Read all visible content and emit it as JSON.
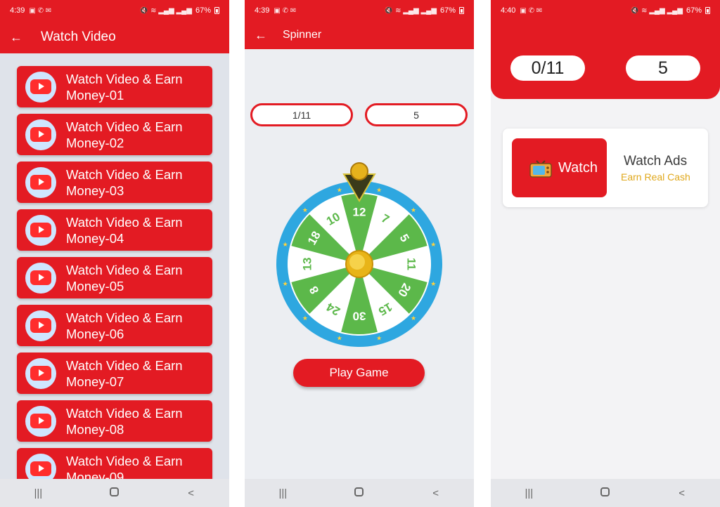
{
  "phone1": {
    "status": {
      "time": "4:39",
      "battery": "67%"
    },
    "appbar": {
      "title": "Watch Video"
    },
    "items": [
      {
        "label": "Watch Video & Earn Money-01"
      },
      {
        "label": "Watch Video & Earn Money-02"
      },
      {
        "label": "Watch Video & Earn Money-03"
      },
      {
        "label": "Watch Video & Earn Money-04"
      },
      {
        "label": "Watch Video & Earn Money-05"
      },
      {
        "label": "Watch Video & Earn Money-06"
      },
      {
        "label": "Watch Video & Earn Money-07"
      },
      {
        "label": "Watch Video & Earn Money-08"
      },
      {
        "label": "Watch Video & Earn Money-09"
      }
    ]
  },
  "phone2": {
    "status": {
      "time": "4:39",
      "battery": "67%"
    },
    "appbar": {
      "title": "Spinner"
    },
    "progress": "1/11",
    "points": "5",
    "wheel_values": [
      "12",
      "7",
      "5",
      "11",
      "20",
      "15",
      "30",
      "24",
      "8",
      "13",
      "18",
      "10"
    ],
    "play_button": "Play Game"
  },
  "phone3": {
    "status": {
      "time": "4:40",
      "battery": "67%"
    },
    "progress": "0/11",
    "points": "5",
    "watch_button": "Watch",
    "ads_title": "Watch Ads",
    "ads_subtitle": "Earn Real Cash"
  },
  "icons": {
    "back": "arrow-left-icon",
    "video": "youtube-play-icon",
    "tv": "tv-icon",
    "nav_recent": "recent-apps-icon",
    "nav_home": "home-icon",
    "nav_back": "nav-back-icon"
  },
  "colors": {
    "primary": "#e31b23",
    "wheel_green": "#5cb84a",
    "wheel_rim": "#2ea7e0",
    "accent_gold": "#e0a81c"
  }
}
